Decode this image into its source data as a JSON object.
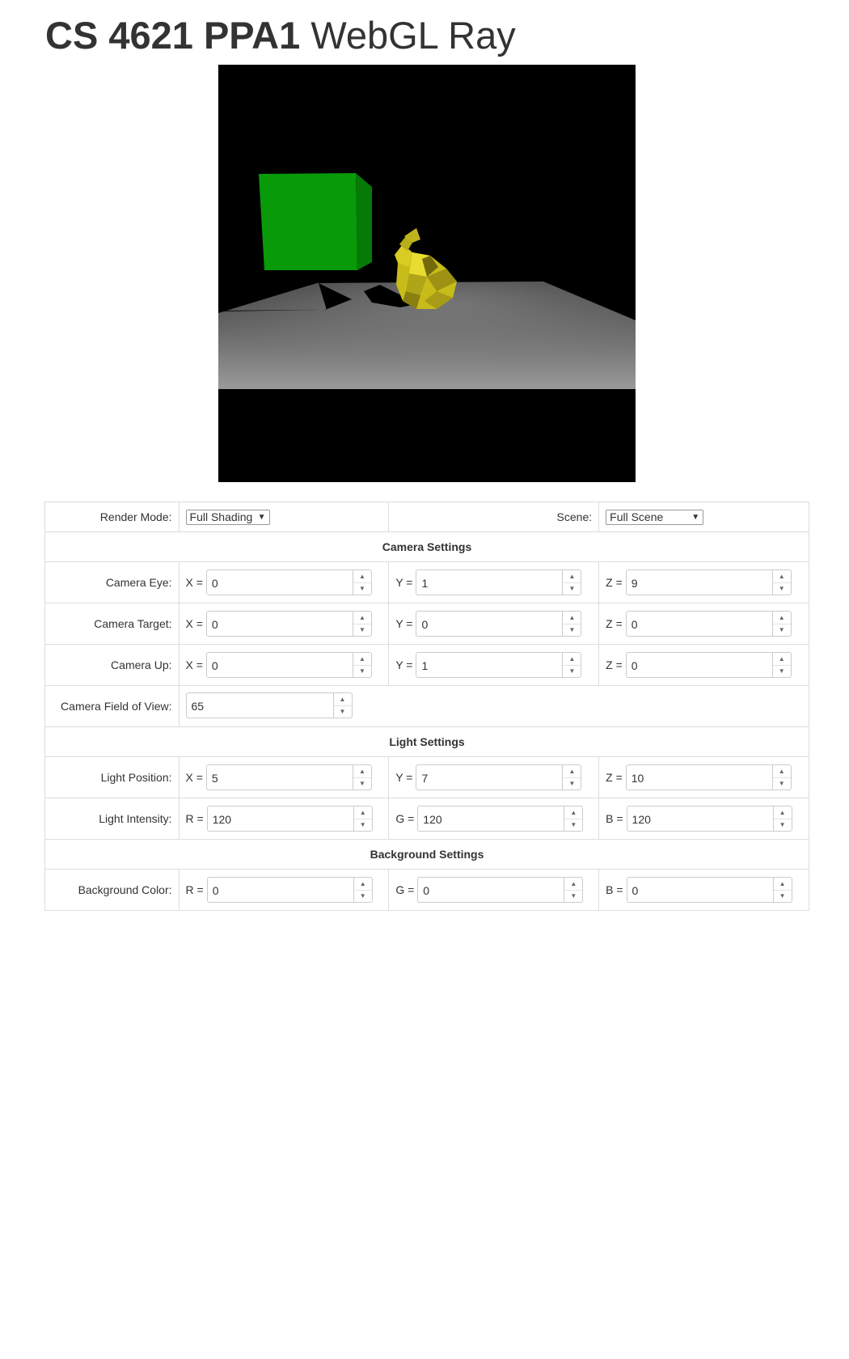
{
  "header": {
    "title_bold": "CS 4621 PPA1",
    "title_rest": "WebGL Ray"
  },
  "render_mode": {
    "label": "Render Mode:",
    "value": "Full Shading"
  },
  "scene": {
    "label": "Scene:",
    "value": "Full Scene"
  },
  "sections": {
    "camera": "Camera Settings",
    "light": "Light Settings",
    "background": "Background Settings"
  },
  "camera_eye": {
    "label": "Camera Eye:",
    "x_label": "X =",
    "x": "0",
    "y_label": "Y =",
    "y": "1",
    "z_label": "Z =",
    "z": "9"
  },
  "camera_target": {
    "label": "Camera Target:",
    "x_label": "X =",
    "x": "0",
    "y_label": "Y =",
    "y": "0",
    "z_label": "Z =",
    "z": "0"
  },
  "camera_up": {
    "label": "Camera Up:",
    "x_label": "X =",
    "x": "0",
    "y_label": "Y =",
    "y": "1",
    "z_label": "Z =",
    "z": "0"
  },
  "camera_fov": {
    "label": "Camera Field of View:",
    "value": "65"
  },
  "light_position": {
    "label": "Light Position:",
    "x_label": "X =",
    "x": "5",
    "y_label": "Y =",
    "y": "7",
    "z_label": "Z =",
    "z": "10"
  },
  "light_intensity": {
    "label": "Light Intensity:",
    "r_label": "R =",
    "r": "120",
    "g_label": "G =",
    "g": "120",
    "b_label": "B =",
    "b": "120"
  },
  "background_color": {
    "label": "Background Color:",
    "r_label": "R =",
    "r": "0",
    "g_label": "G =",
    "g": "0",
    "b_label": "B =",
    "b": "0"
  },
  "icons": {
    "spinner_up": "▲",
    "spinner_down": "▼",
    "dropdown": "▼"
  },
  "colors": {
    "cube": "#089a08",
    "bunny": "#c8bc1a",
    "floor": "#8a8a8a",
    "canvas_bg": "#000000"
  }
}
